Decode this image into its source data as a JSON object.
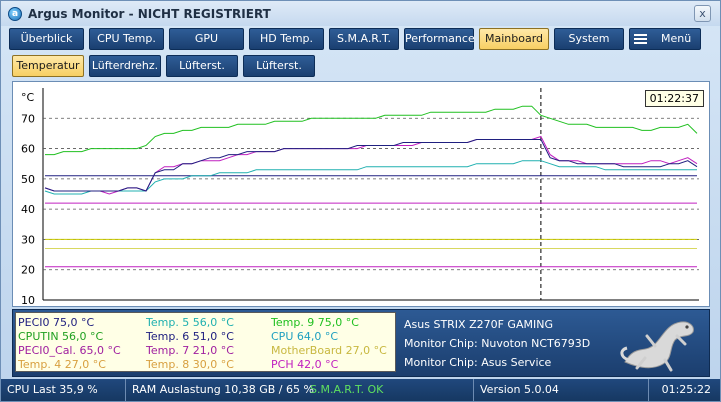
{
  "window": {
    "title": "Argus Monitor - NICHT REGISTRIERT",
    "close_label": "x"
  },
  "tabs": [
    {
      "label": "Überblick",
      "active": false
    },
    {
      "label": "CPU Temp.",
      "active": false
    },
    {
      "label": "GPU",
      "active": false
    },
    {
      "label": "HD Temp.",
      "active": false
    },
    {
      "label": "S.M.A.R.T.",
      "active": false
    },
    {
      "label": "Performance",
      "active": false
    },
    {
      "label": "Mainboard",
      "active": true
    },
    {
      "label": "System",
      "active": false
    },
    {
      "label": "Menü",
      "active": false
    }
  ],
  "subtabs": [
    {
      "label": "Temperatur",
      "active": true
    },
    {
      "label": "Lüfterdrehz.",
      "active": false
    },
    {
      "label": "Lüfterst.",
      "active": false
    },
    {
      "label": "Lüfterst.",
      "active": false
    }
  ],
  "chart_data": {
    "type": "line",
    "y_unit_label": "°C",
    "ylim": [
      10,
      80
    ],
    "yticks": [
      "70",
      "60",
      "50",
      "40",
      "30",
      "20",
      "10"
    ],
    "grid": true,
    "time_marker_label": "01:22:37",
    "series": [
      {
        "name": "CPUTIN",
        "color": "#20c020",
        "values": [
          58,
          58,
          59,
          59,
          59,
          60,
          60,
          60,
          60,
          60,
          60,
          61,
          64,
          65,
          65,
          66,
          66,
          67,
          67,
          67,
          67,
          68,
          68,
          68,
          68,
          69,
          69,
          69,
          69,
          70,
          70,
          70,
          70,
          70,
          70,
          70,
          70,
          71,
          71,
          71,
          71,
          71,
          72,
          72,
          72,
          72,
          72,
          72,
          72,
          73,
          73,
          73,
          74,
          74,
          71,
          70,
          69,
          68,
          68,
          68,
          67,
          67,
          67,
          67,
          67,
          66,
          66,
          67,
          67,
          67,
          68,
          65
        ]
      },
      {
        "name": "PECI0",
        "color": "#202080",
        "values": [
          47,
          46,
          46,
          46,
          46,
          46,
          46,
          46,
          46,
          47,
          47,
          46,
          52,
          53,
          53,
          55,
          55,
          56,
          57,
          57,
          58,
          58,
          59,
          59,
          59,
          59,
          60,
          60,
          60,
          60,
          60,
          60,
          60,
          60,
          61,
          61,
          61,
          61,
          61,
          62,
          62,
          62,
          62,
          62,
          62,
          62,
          62,
          63,
          63,
          63,
          63,
          63,
          63,
          63,
          63,
          57,
          56,
          56,
          55,
          55,
          55,
          55,
          55,
          54,
          54,
          54,
          54,
          54,
          55,
          55,
          56,
          54
        ]
      },
      {
        "name": "PECI0_Cal.",
        "color": "#c020c0",
        "values": [
          47,
          46,
          46,
          46,
          46,
          46,
          46,
          45,
          46,
          47,
          47,
          46,
          52,
          54,
          54,
          55,
          55,
          56,
          56,
          56,
          57,
          58,
          58,
          59,
          59,
          59,
          60,
          60,
          60,
          60,
          60,
          60,
          60,
          60,
          60,
          61,
          61,
          61,
          61,
          61,
          61,
          62,
          62,
          62,
          62,
          62,
          62,
          63,
          63,
          63,
          63,
          63,
          63,
          63,
          64,
          58,
          56,
          56,
          56,
          55,
          55,
          55,
          55,
          55,
          55,
          55,
          56,
          56,
          55,
          56,
          57,
          55
        ]
      },
      {
        "name": "CPU",
        "color": "#20b0b0",
        "values": [
          46,
          45,
          45,
          45,
          45,
          46,
          46,
          46,
          46,
          46,
          46,
          46,
          49,
          50,
          50,
          50,
          51,
          51,
          51,
          52,
          52,
          52,
          52,
          53,
          53,
          53,
          53,
          53,
          53,
          53,
          53,
          53,
          53,
          53,
          53,
          54,
          54,
          54,
          54,
          54,
          54,
          54,
          54,
          54,
          54,
          54,
          54,
          55,
          55,
          55,
          55,
          55,
          56,
          56,
          56,
          55,
          54,
          54,
          54,
          54,
          54,
          53,
          53,
          53,
          53,
          53,
          53,
          53,
          53,
          53,
          53,
          53
        ]
      },
      {
        "name": "Temp. 6",
        "color": "#202080",
        "values": [
          51,
          51,
          51,
          51,
          51,
          51,
          51,
          51,
          51,
          51,
          51,
          51,
          51,
          51,
          51,
          51,
          51,
          51,
          51,
          51,
          51,
          51,
          51,
          51,
          51,
          51,
          51,
          51,
          51,
          51,
          51,
          51,
          51,
          51,
          51,
          51,
          51,
          51,
          51,
          51,
          51,
          51,
          51,
          51,
          51,
          51,
          51,
          51,
          51,
          51,
          51,
          51,
          51,
          51,
          51,
          51,
          51,
          51,
          51,
          51,
          51,
          51,
          51,
          51,
          51,
          51,
          51,
          51,
          51,
          51,
          51,
          51
        ]
      },
      {
        "name": "PCH",
        "color": "#c020c0",
        "values": [
          42,
          42,
          42,
          42,
          42,
          42,
          42,
          42,
          42,
          42,
          42,
          42,
          42,
          42,
          42,
          42,
          42,
          42,
          42,
          42,
          42,
          42,
          42,
          42,
          42,
          42,
          42,
          42,
          42,
          42,
          42,
          42,
          42,
          42,
          42,
          42,
          42,
          42,
          42,
          42,
          42,
          42,
          42,
          42,
          42,
          42,
          42,
          42,
          42,
          42,
          42,
          42,
          42,
          42,
          42,
          42,
          42,
          42,
          42,
          42,
          42,
          42,
          42,
          42,
          42,
          42,
          42,
          42,
          42,
          42,
          42,
          42
        ]
      },
      {
        "name": "Temp. 8",
        "color": "#c8c800",
        "values": [
          30,
          30,
          30,
          30,
          30,
          30,
          30,
          30,
          30,
          30,
          30,
          30,
          30,
          30,
          30,
          30,
          30,
          30,
          30,
          30,
          30,
          30,
          30,
          30,
          30,
          30,
          30,
          30,
          30,
          30,
          30,
          30,
          30,
          30,
          30,
          30,
          30,
          30,
          30,
          30,
          30,
          30,
          30,
          30,
          30,
          30,
          30,
          30,
          30,
          30,
          30,
          30,
          30,
          30,
          30,
          30,
          30,
          30,
          30,
          30,
          30,
          30,
          30,
          30,
          30,
          30,
          30,
          30,
          30,
          30,
          30,
          30
        ]
      },
      {
        "name": "MotherBoard",
        "color": "#d8d860",
        "values": [
          27,
          27,
          27,
          27,
          27,
          27,
          27,
          27,
          27,
          27,
          27,
          27,
          27,
          27,
          27,
          27,
          27,
          27,
          27,
          27,
          27,
          27,
          27,
          27,
          27,
          27,
          27,
          27,
          27,
          27,
          27,
          27,
          27,
          27,
          27,
          27,
          27,
          27,
          27,
          27,
          27,
          27,
          27,
          27,
          27,
          27,
          27,
          27,
          27,
          27,
          27,
          27,
          27,
          27,
          27,
          27,
          27,
          27,
          27,
          27,
          27,
          27,
          27,
          27,
          27,
          27,
          27,
          27,
          27,
          27,
          27,
          27
        ]
      },
      {
        "name": "Temp. 7",
        "color": "#c020c0",
        "values": [
          21,
          21,
          21,
          21,
          21,
          21,
          21,
          21,
          21,
          21,
          21,
          21,
          21,
          21,
          21,
          21,
          21,
          21,
          21,
          21,
          21,
          21,
          21,
          21,
          21,
          21,
          21,
          21,
          21,
          21,
          21,
          21,
          21,
          21,
          21,
          21,
          21,
          21,
          21,
          21,
          21,
          21,
          21,
          21,
          21,
          21,
          21,
          21,
          21,
          21,
          21,
          21,
          21,
          21,
          21,
          21,
          21,
          21,
          21,
          21,
          21,
          21,
          21,
          21,
          21,
          21,
          21,
          21,
          21,
          21,
          21,
          21
        ]
      }
    ]
  },
  "legend": [
    {
      "label": "PECI0 75,0 °C",
      "color": "#202080"
    },
    {
      "label": "Temp. 5 56,0 °C",
      "color": "#20b0b0"
    },
    {
      "label": "Temp. 9 75,0 °C",
      "color": "#20c020"
    },
    {
      "label": "CPUTIN 56,0 °C",
      "color": "#20a020"
    },
    {
      "label": "Temp. 6 51,0 °C",
      "color": "#202080"
    },
    {
      "label": "CPU 64,0 °C",
      "color": "#20a0c0"
    },
    {
      "label": "PECI0_Cal. 65,0 °C",
      "color": "#a020a0"
    },
    {
      "label": "Temp. 7 21,0 °C",
      "color": "#a020a0"
    },
    {
      "label": "MotherBoard 27,0 °C",
      "color": "#c8b840"
    },
    {
      "label": "Temp. 4 27,0 °C",
      "color": "#d8a040"
    },
    {
      "label": "Temp. 8 30,0 °C",
      "color": "#d8a040"
    },
    {
      "label": "PCH 42,0 °C",
      "color": "#c020c0"
    }
  ],
  "info": {
    "board": "Asus STRIX Z270F GAMING",
    "chip1": "Monitor Chip: Nuvoton NCT6793D",
    "chip2": "Monitor Chip: Asus Service"
  },
  "status": {
    "cpu_last": "CPU Last 35,9 %",
    "ram": "RAM Auslastung 10,38 GB / 65 %",
    "smart": "S.M.A.R.T. OK",
    "smart_color": "#5fe05f",
    "version": "Version 5.0.04",
    "clock": "01:25:22"
  }
}
